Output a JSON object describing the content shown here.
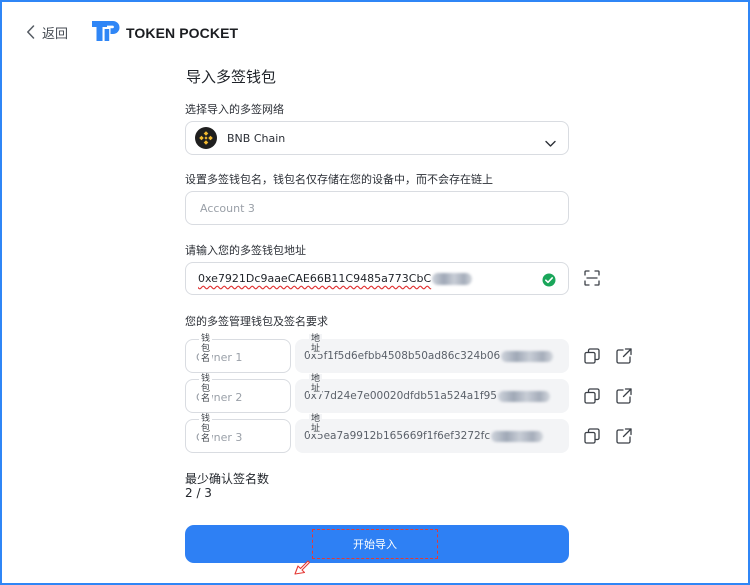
{
  "header": {
    "back_label": "返回",
    "brand_name": "TOKEN POCKET"
  },
  "page": {
    "title": "导入多签钱包"
  },
  "network": {
    "label": "选择导入的多签网络",
    "selected": "BNB Chain",
    "icon": "bnb-chain-icon"
  },
  "wallet_name": {
    "label": "设置多签钱包名，钱包名仅存储在您的设备中，而不会存在链上",
    "placeholder": "Account 3",
    "value": ""
  },
  "multisig_address": {
    "label": "请输入您的多签钱包地址",
    "value": "0xe7921Dc9aaeCAE66B11C9485a773CbC",
    "valid": true
  },
  "owners": {
    "label": "您的多签管理钱包及签名要求",
    "name_legend": "钱包名",
    "address_legend": "地址",
    "items": [
      {
        "placeholder": "Owner 1",
        "address": "0x5f1f5d6efbb4508b50ad86c324b06"
      },
      {
        "placeholder": "Owner 2",
        "address": "0x77d24e7e00020dfdb51a524a1f95"
      },
      {
        "placeholder": "Owner 3",
        "address": "0x5ea7a9912b165669f1f6ef3272fc"
      }
    ]
  },
  "threshold": {
    "label": "最少确认签名数",
    "value": "2 / 3"
  },
  "submit": {
    "label": "开始导入"
  },
  "colors": {
    "accent": "#2e80f4",
    "brand": "#2f86f6",
    "success": "#1aa65a",
    "error_underline": "#e03030"
  }
}
